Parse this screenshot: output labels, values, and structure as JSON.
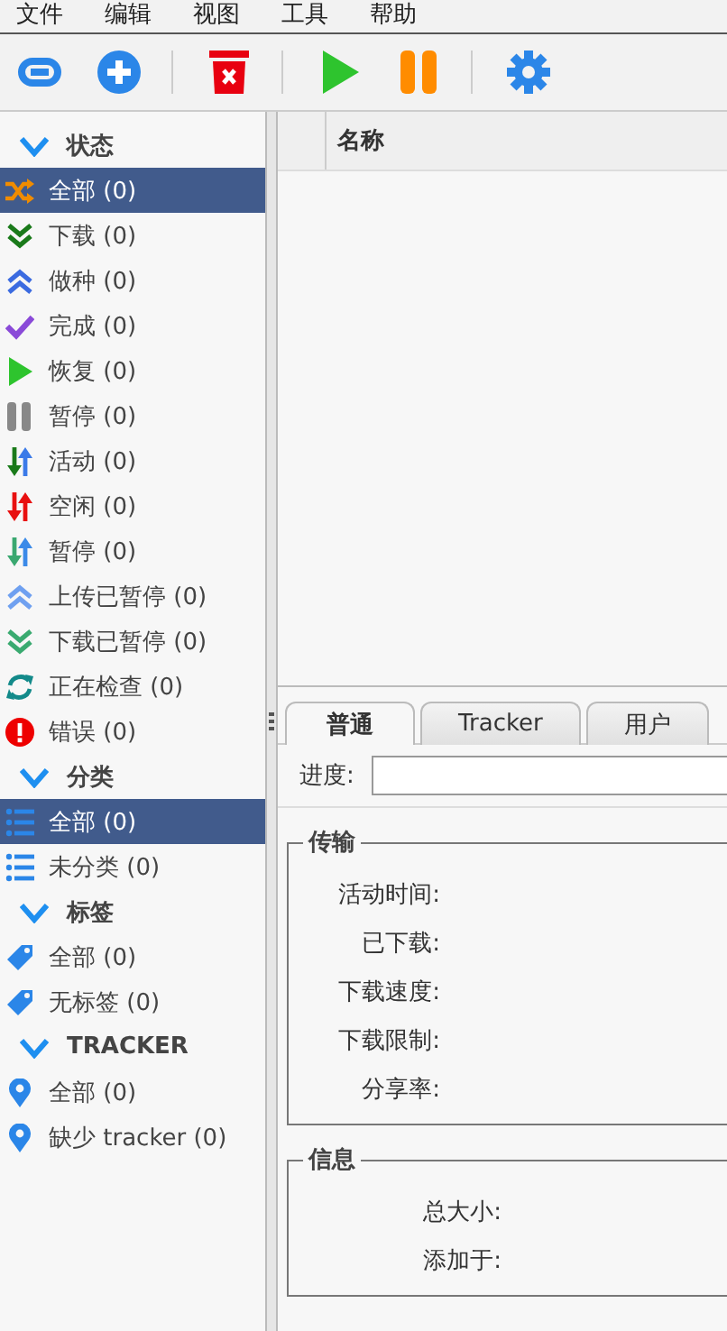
{
  "menu": [
    "文件",
    "编辑",
    "视图",
    "工具",
    "帮助"
  ],
  "sidebar": {
    "groups": [
      {
        "title": "状态",
        "expanded": true,
        "kind": "status",
        "items": [
          {
            "label": "全部 (0)",
            "selected": true
          },
          {
            "label": "下载 (0)",
            "selected": false
          },
          {
            "label": "做种 (0)",
            "selected": false
          },
          {
            "label": "完成 (0)",
            "selected": false
          },
          {
            "label": "恢复 (0)",
            "selected": false
          },
          {
            "label": "暂停 (0)",
            "selected": false
          },
          {
            "label": "活动 (0)",
            "selected": false
          },
          {
            "label": "空闲 (0)",
            "selected": false
          },
          {
            "label": "暂停 (0)",
            "selected": false
          },
          {
            "label": "上传已暂停 (0)",
            "selected": false
          },
          {
            "label": "下载已暂停 (0)",
            "selected": false
          },
          {
            "label": "正在检查 (0)",
            "selected": false
          },
          {
            "label": "错误 (0)",
            "selected": false
          }
        ]
      },
      {
        "title": "分类",
        "expanded": true,
        "kind": "category",
        "items": [
          {
            "label": "全部 (0)",
            "selected": true
          },
          {
            "label": "未分类 (0)",
            "selected": false
          }
        ]
      },
      {
        "title": "标签",
        "expanded": true,
        "kind": "tag",
        "items": [
          {
            "label": "全部 (0)",
            "selected": false
          },
          {
            "label": "无标签 (0)",
            "selected": false
          }
        ]
      },
      {
        "title": "TRACKER",
        "expanded": true,
        "kind": "tracker",
        "items": [
          {
            "label": "全部 (0)",
            "selected": false
          },
          {
            "label": "缺少 tracker (0)",
            "selected": false
          }
        ]
      }
    ]
  },
  "table": {
    "columns": [
      "名称"
    ]
  },
  "tabs": [
    {
      "label": "普通",
      "selected": true
    },
    {
      "label": "Tracker",
      "selected": false
    },
    {
      "label": "用户",
      "selected": false
    }
  ],
  "progress": {
    "label": "进度:",
    "level": 0
  },
  "sections": [
    {
      "title": "传输",
      "fields": [
        "活动时间:",
        "已下载:",
        "下载速度:",
        "下载限制:",
        "分享率:"
      ]
    },
    {
      "title": "信息",
      "fields": [
        "总大小:",
        "添加于:"
      ]
    }
  ]
}
